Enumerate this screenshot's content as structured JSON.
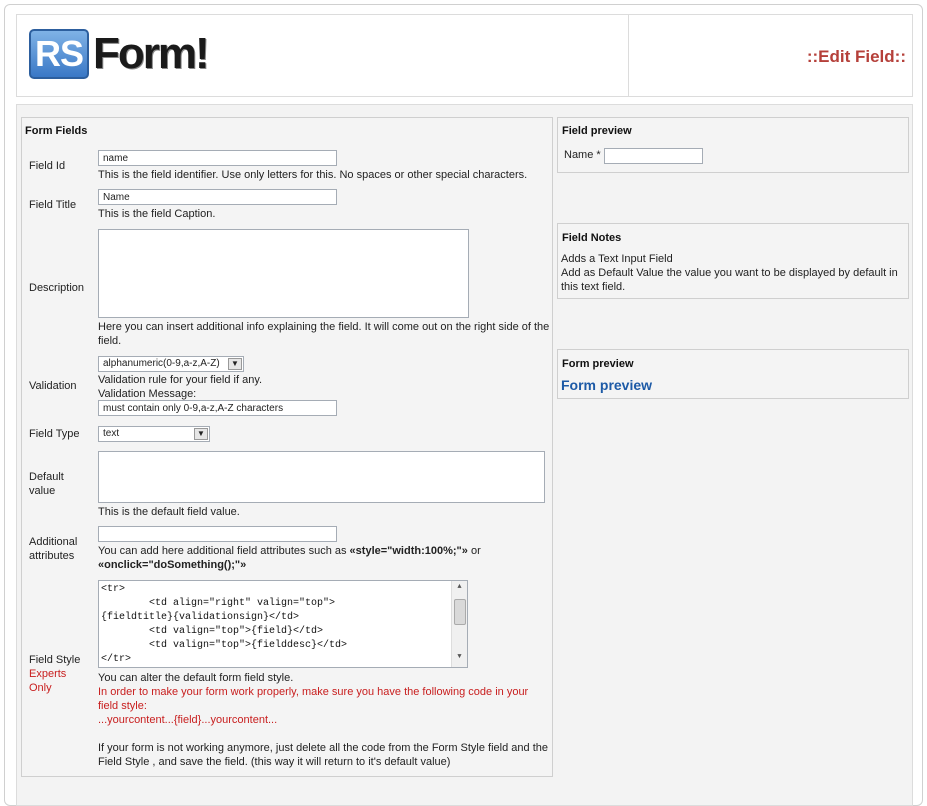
{
  "header": {
    "logo_rs": "RS",
    "logo_form": "Form!",
    "title": "::Edit Field::"
  },
  "form_fields": {
    "title": "Form Fields",
    "field_id": {
      "label": "Field Id",
      "value": "name",
      "help": "This is the field identifier. Use only letters for this. No spaces or other special characters."
    },
    "field_title": {
      "label": "Field Title",
      "value": "Name",
      "help": "This is the field Caption."
    },
    "description": {
      "label": "Description",
      "value": "",
      "help_line1": "Here you can insert additional info explaining the field. It will come out on the right side of the",
      "help_line2": "field."
    },
    "validation": {
      "label": "Validation",
      "selected": "alphanumeric(0-9,a-z,A-Z)",
      "help": "Validation rule for your field if any.",
      "message_label": "Validation Message:",
      "message_value": "must contain only 0-9,a-z,A-Z characters"
    },
    "field_type": {
      "label": "Field Type",
      "selected": "text"
    },
    "default_value": {
      "label_line1": "Default",
      "label_line2": "value",
      "value": "",
      "help": "This is the default field value."
    },
    "additional_attributes": {
      "label_line1": "Additional",
      "label_line2": "attributes",
      "value": "",
      "help_pre": "You can add here additional field attributes such as ",
      "help_code1": "«style=\"width:100%;\"»",
      "help_mid": " or",
      "help_code2": "«onclick=\"doSomething();\"»"
    },
    "field_style": {
      "label": "Field Style",
      "experts_line1": "Experts",
      "experts_line2": "Only",
      "code": "<tr>\n\t<td align=\"right\" valign=\"top\">\n{fieldtitle}{validationsign}</td>\n\t<td valign=\"top\">{field}</td>\n\t<td valign=\"top\">{fielddesc}</td>\n</tr>",
      "help": "You can alter the default form field style.",
      "warning_line1": "In order to make your form work properly, make sure you have the following code in your",
      "warning_line2": "field style:",
      "warning_code": "...yourcontent...{field}...yourcontent...",
      "reset_line1": "If your form is not working anymore, just delete all the code from the Form Style field and the",
      "reset_line2": "Field Style , and save the field. (this way it will return to it's default value)"
    }
  },
  "field_preview": {
    "title": "Field preview",
    "name_label": "Name *",
    "name_value": ""
  },
  "field_notes": {
    "title": "Field Notes",
    "line1": "Adds a Text Input Field",
    "line2": "Add as Default Value the value you want to be displayed by default in",
    "line3": "this text field."
  },
  "form_preview": {
    "title": "Form preview",
    "link": "Form preview"
  },
  "colors": {
    "title_red": "#b5403a",
    "warning_red": "#c81e1e",
    "link_blue": "#1d5aa6"
  }
}
